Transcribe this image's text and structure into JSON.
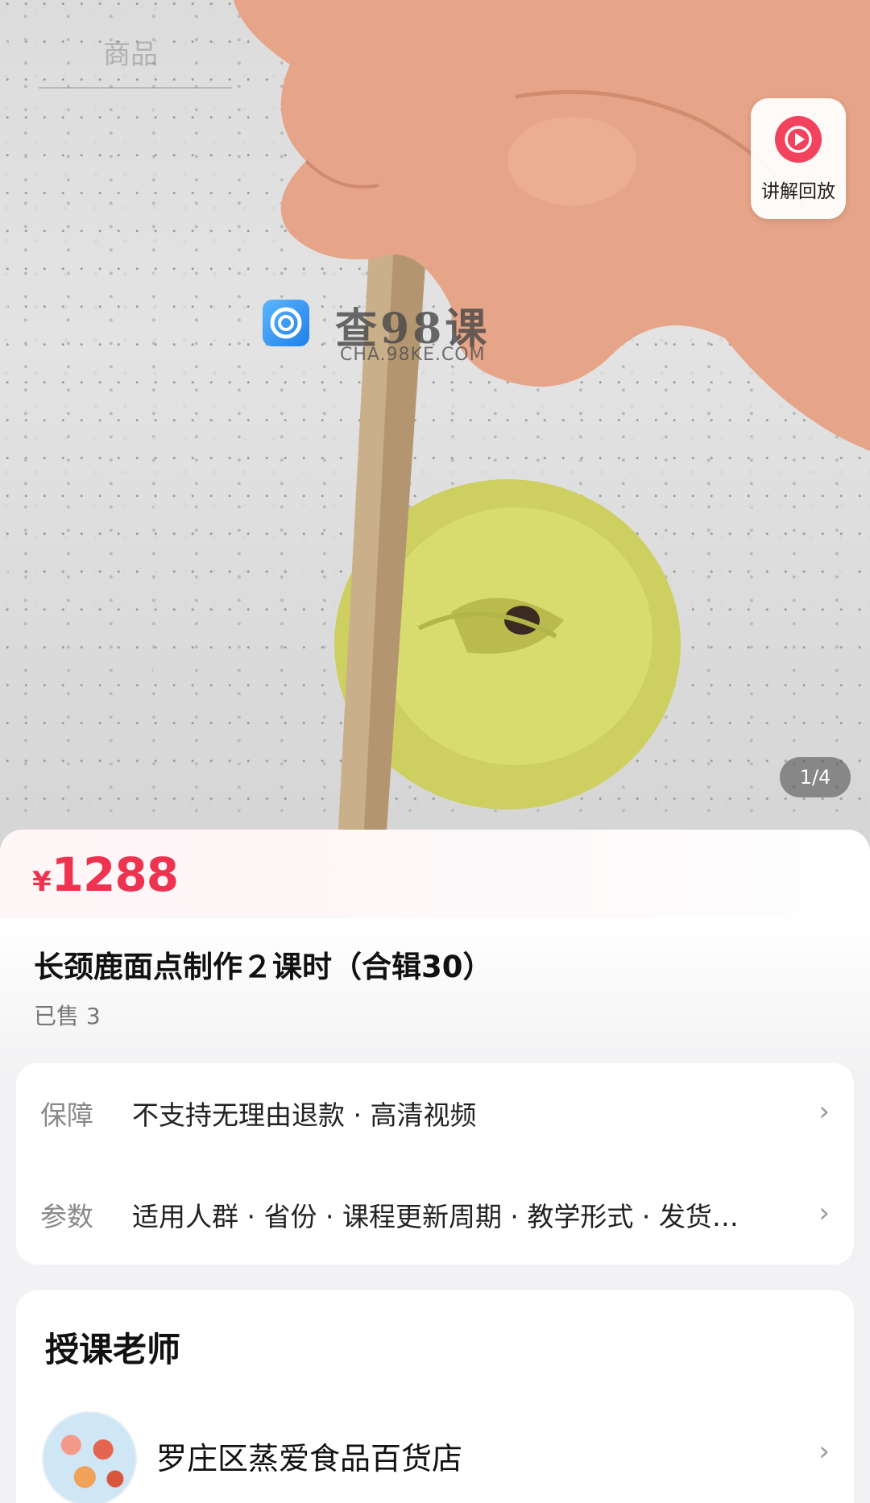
{
  "header": {
    "tab_label": "商品"
  },
  "replay": {
    "label": "讲解回放",
    "accent": "#f1425e"
  },
  "watermark": {
    "title": "查98课",
    "subtitle": "CHA.98KE.COM"
  },
  "gallery": {
    "counter": "1/4"
  },
  "product": {
    "currency": "¥",
    "price": "1288",
    "price_color": "#ee3350",
    "title": "长颈鹿面点制作２课时（合辑30）",
    "sold": "已售 3"
  },
  "specs": [
    {
      "key": "保障",
      "value": "不支持无理由退款 · 高清视频"
    },
    {
      "key": "参数",
      "value": "适用人群 · 省份 · 课程更新周期 · 教学形式 · 发货…"
    }
  ],
  "teacher": {
    "section_title": "授课老师",
    "shop_name": "罗庄区蒸爱食品百货店"
  },
  "icons": {
    "chevron": "›"
  }
}
